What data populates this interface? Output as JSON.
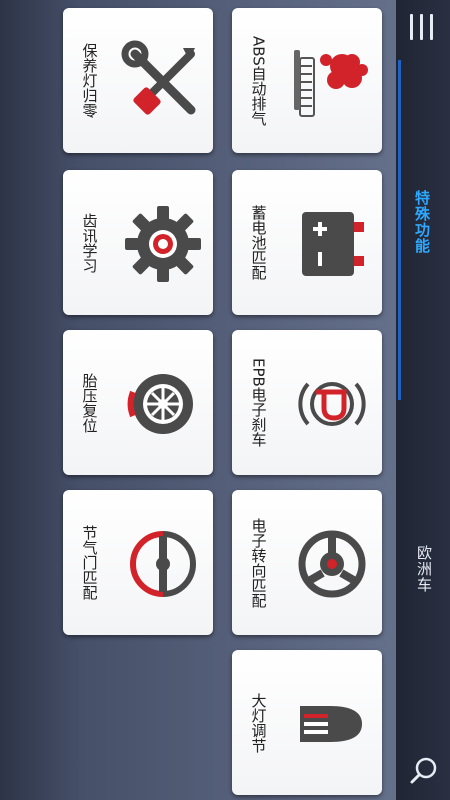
{
  "header": {
    "tabs": [
      {
        "label": "特殊功能",
        "active": true
      },
      {
        "label": "欧洲车",
        "active": false
      }
    ],
    "menu_icon": "menu-icon",
    "search_icon": "search-icon"
  },
  "functions": [
    {
      "label": "ABS自动排气",
      "icon": "abs-bleed-icon"
    },
    {
      "label": "保养灯归零",
      "icon": "maintenance-tools-icon"
    },
    {
      "label": "蓄电池匹配",
      "icon": "battery-icon"
    },
    {
      "label": "齿讯学习",
      "icon": "gear-icon"
    },
    {
      "label": "EPB电子刹车",
      "icon": "parking-brake-icon"
    },
    {
      "label": "胎压复位",
      "icon": "tire-pressure-icon"
    },
    {
      "label": "电子转向匹配",
      "icon": "steering-wheel-icon"
    },
    {
      "label": "节气门匹配",
      "icon": "throttle-icon"
    },
    {
      "label": "大灯调节",
      "icon": "headlight-icon"
    }
  ],
  "colors": {
    "accent_red": "#d2232a",
    "icon_dark": "#4a4a4a",
    "active_tab": "#2ea7ff",
    "tab_indicator": "#1e63c4"
  }
}
